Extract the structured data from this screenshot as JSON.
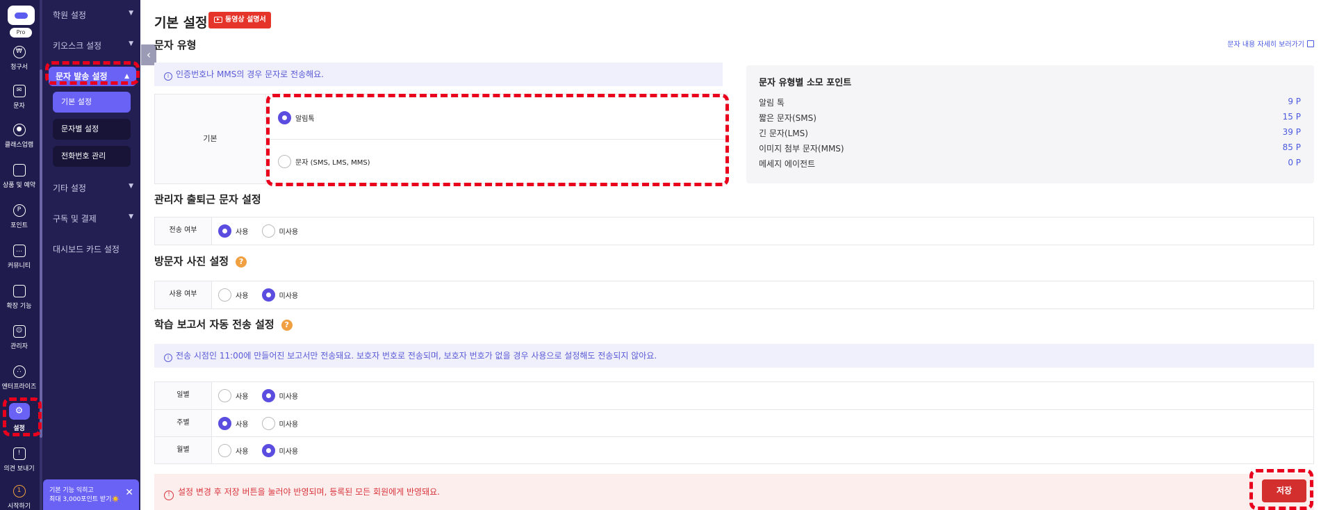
{
  "rail": {
    "pro": "Pro",
    "items": [
      {
        "label": "청구서",
        "icon": "won-icon"
      },
      {
        "label": "문자",
        "icon": "mail-icon"
      },
      {
        "label": "클래스업램",
        "icon": "location-icon"
      },
      {
        "label": "상품 및 예약",
        "icon": "bag-icon"
      },
      {
        "label": "포인트",
        "icon": "point-icon"
      },
      {
        "label": "커뮤니티",
        "icon": "chat-icon"
      },
      {
        "label": "확장 기능",
        "icon": "puzzle-icon"
      },
      {
        "label": "관리자",
        "icon": "admin-icon"
      },
      {
        "label": "엔터프라이즈",
        "icon": "enterprise-icon"
      },
      {
        "label": "설정",
        "icon": "gear-icon"
      },
      {
        "label": "의견 보내기",
        "icon": "feedback-icon"
      },
      {
        "label": "시작하기",
        "icon": "start-icon"
      }
    ]
  },
  "submenu": {
    "academy": "학원 설정",
    "kiosk": "키오스크 설정",
    "sms": "문자 발송 설정",
    "sms_children": [
      "기본 설정",
      "문자별 설정",
      "전화번호 관리"
    ],
    "etc": "기타 설정",
    "subscription": "구독 및 결제",
    "dashboard": "대시보드 카드 설정"
  },
  "tip": {
    "line1": "기본 기능 익히고",
    "line2": "최대 3,000포인트 받기☀️"
  },
  "page": {
    "title": "기본 설정",
    "video_btn": "동영상 설명서"
  },
  "sms_type": {
    "title": "문자 유형",
    "detail_link": "문자 내용 자세히 보러가기",
    "notice": "인증번호나 MMS의 경우 문자로 전송해요.",
    "row_label": "기본",
    "options": [
      "알림톡",
      "문자 (SMS, LMS, MMS)"
    ],
    "selected": 0
  },
  "points": {
    "title": "문자 유형별 소모 포인트",
    "rows": [
      {
        "name": "알림 톡",
        "value": "9 P"
      },
      {
        "name": "짧은 문자(SMS)",
        "value": "15 P"
      },
      {
        "name": "긴 문자(LMS)",
        "value": "39 P"
      },
      {
        "name": "이미지 첨부 문자(MMS)",
        "value": "85 P"
      },
      {
        "name": "메세지 에이전트",
        "value": "0 P"
      }
    ]
  },
  "opt_labels": {
    "use": "사용",
    "not_use": "미사용"
  },
  "commute": {
    "title": "관리자 출퇴근 문자 설정",
    "row_label": "전송 여부",
    "selected": "use"
  },
  "photo": {
    "title": "방문자 사진 설정",
    "row_label": "사용 여부",
    "selected": "not_use"
  },
  "report": {
    "title": "학습 보고서 자동 전송 설정",
    "notice": "전송 시점인 11:00에 만들어진 보고서만 전송돼요. 보호자 번호로 전송되며, 보호자 번호가 없을 경우 사용으로 설정해도 전송되지 않아요.",
    "rows": [
      {
        "label": "일별",
        "selected": "not_use"
      },
      {
        "label": "주별",
        "selected": "use"
      },
      {
        "label": "월별",
        "selected": "not_use"
      }
    ]
  },
  "footer": {
    "warning": "설정 변경 후 저장 버튼을 눌러야 반영되며, 등록된 모든 회원에게 반영돼요.",
    "save": "저장"
  },
  "colors": {
    "accent": "#6a62f5",
    "danger": "#d32f2f",
    "highlight": "#e8001c",
    "sidebar": "#1f1b4d"
  }
}
